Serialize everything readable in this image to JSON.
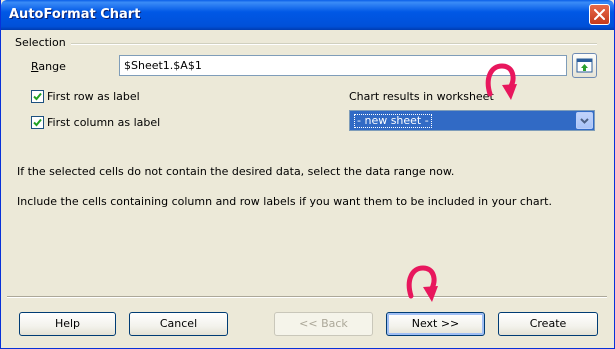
{
  "window": {
    "title": "AutoFormat Chart"
  },
  "selection": {
    "group_label": "Selection",
    "range_label": "Range",
    "range_value": "$Sheet1.$A$1",
    "first_row_label": "First row as label",
    "first_row_checked": true,
    "first_column_label": "First column as label",
    "first_column_checked": true,
    "results_label": "Chart results in worksheet",
    "results_selected": "- new sheet -"
  },
  "info": {
    "line1": "If the selected cells do not contain the desired data, select the data range now.",
    "line2": "Include the cells containing column and row labels if you want them to be included in your chart."
  },
  "buttons": {
    "help": "Help",
    "cancel": "Cancel",
    "back": "<< Back",
    "next": "Next >>",
    "create": "Create"
  },
  "colors": {
    "titlebar": "#0058e6",
    "dialog_bg": "#ece9d8",
    "select_highlight": "#316ac5",
    "annotation_arrow": "#e8175d"
  },
  "icons": {
    "close": "close-icon",
    "shrink": "shrink-range-icon",
    "dropdown": "chevron-down-icon",
    "checkmark": "checkmark-icon",
    "annotation": "curved-arrow-icon"
  }
}
